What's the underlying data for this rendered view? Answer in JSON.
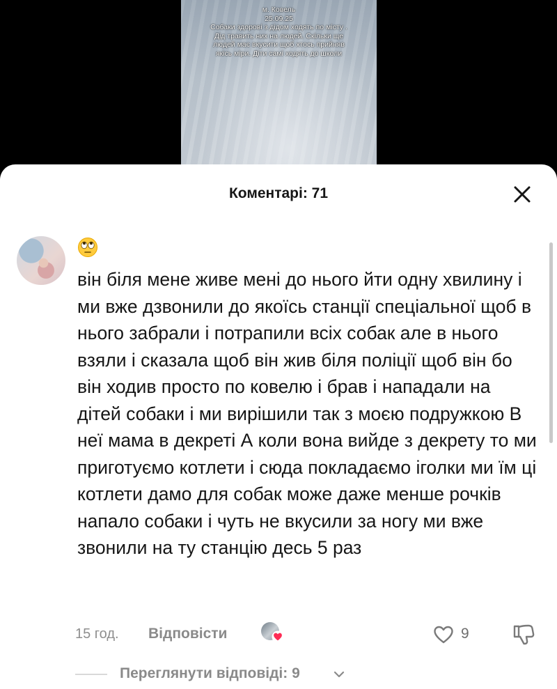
{
  "video": {
    "caption_lines": [
      "м. Ковель",
      "25.09.25",
      "Собаки здорові з дідом ходять по місту .",
      "Дід травить них на людей. Скільки ще",
      "людей має вкусити щоб хтось прийняв",
      "якісь міри. Діти самі ходять до школи"
    ]
  },
  "sheet": {
    "title": "Коментарі: 71",
    "close_icon": "close-icon"
  },
  "comment": {
    "emoji": "🙄",
    "text": "він біля мене живе мені до нього йти одну хвилину і ми вже дзвонили до якоїсь станції спеціальної щоб в нього забрали і потрапили всіх собак але в нього взяли і сказала щоб він жив біля поліції щоб він бо він ходив просто по ковелю і брав і нападали на дітей собаки і ми вирішили так з моєю подружкою В неї мама в декреті А коли вона вийде з декрету то ми приготуємо котлети і сюда покладаємо іголки ми їм ці котлети дамо для собак може даже менше рочків напало собаки і чуть не вкусили за ногу ми вже звонили на ту станцію десь 5 раз",
    "timestamp": "15 год.",
    "reply_label": "Відповісти",
    "like_count": "9",
    "view_replies": "Переглянути відповіді: 9"
  },
  "colors": {
    "accent_heart": "#fe2c55",
    "muted_text": "#8a8a8a"
  }
}
